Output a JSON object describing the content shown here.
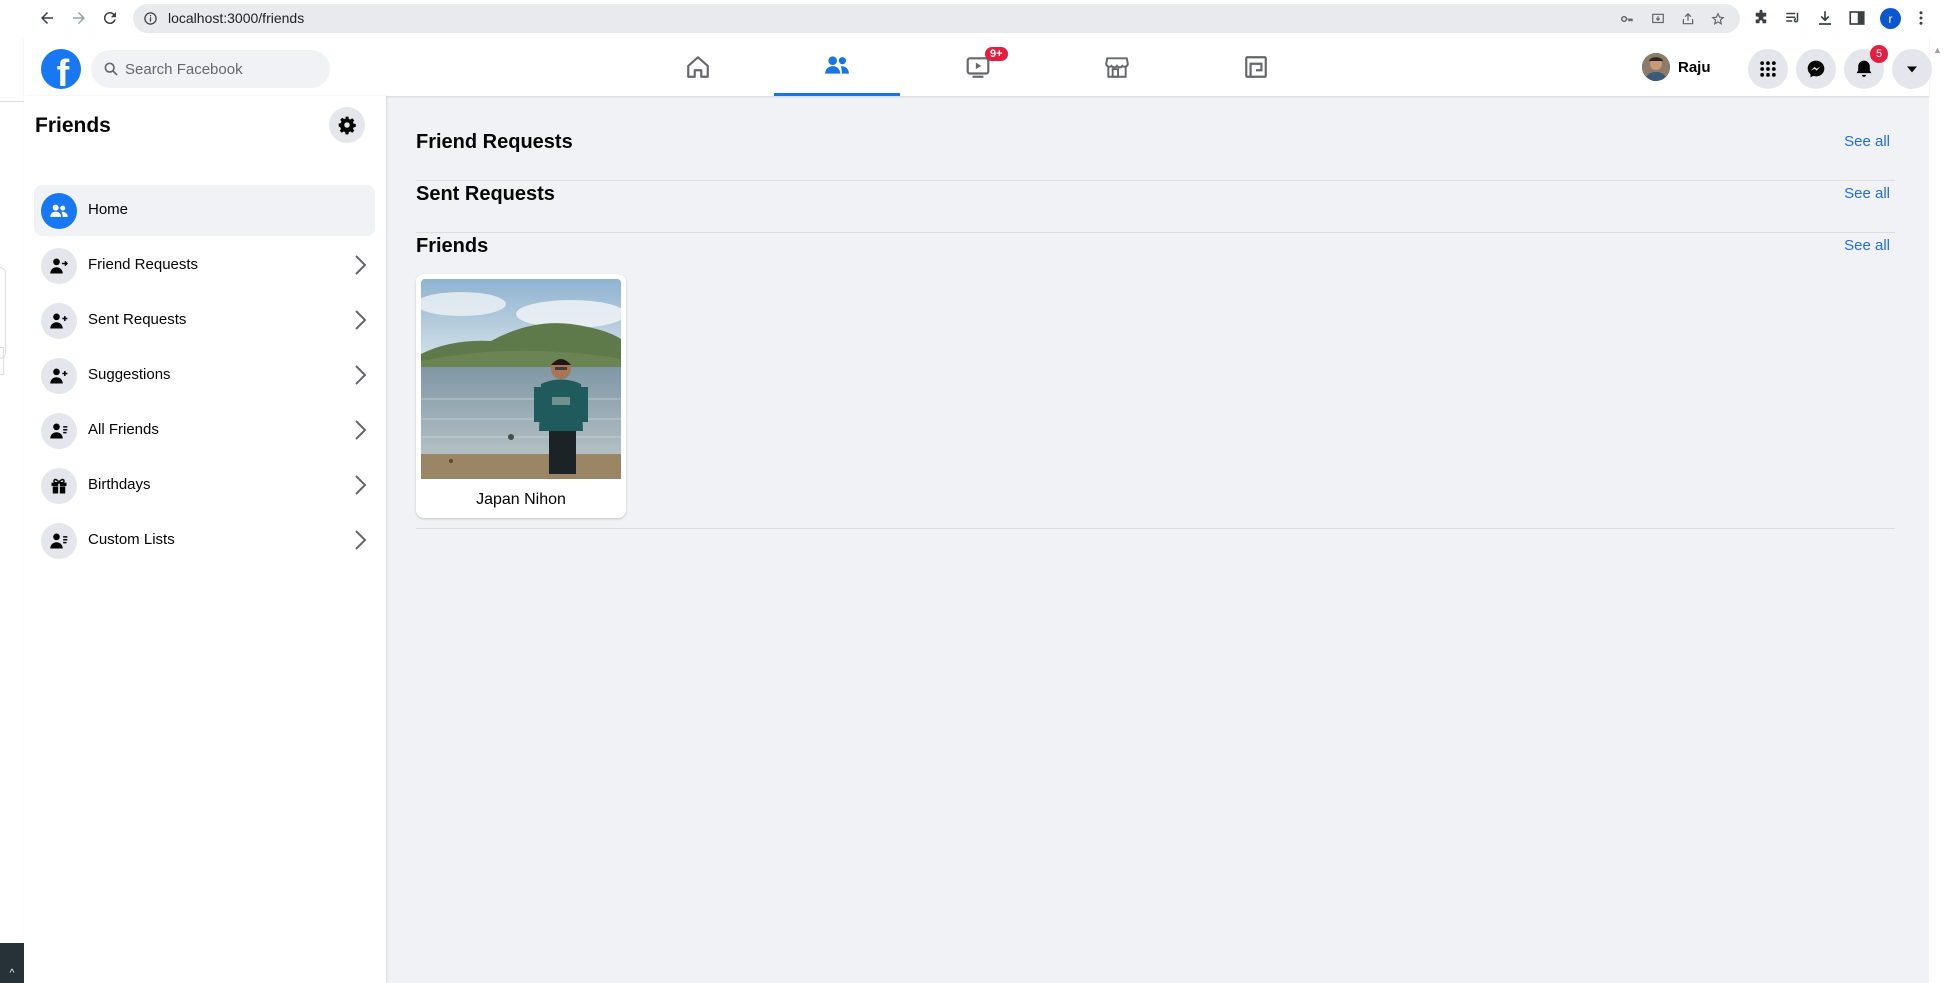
{
  "browser": {
    "url": "localhost:3000/friends",
    "profile_initial": "r"
  },
  "fb_nav": {
    "logo_letter": "f",
    "search_placeholder": "Search Facebook",
    "watch_badge": "9+",
    "user_name": "Raju",
    "notifications_badge": "5"
  },
  "sidebar": {
    "title": "Friends",
    "items": [
      {
        "label": "Home",
        "icon": "friends-home-icon",
        "active": true
      },
      {
        "label": "Friend Requests",
        "icon": "friend-requests-icon"
      },
      {
        "label": "Sent Requests",
        "icon": "sent-requests-icon"
      },
      {
        "label": "Suggestions",
        "icon": "suggestions-icon"
      },
      {
        "label": "All Friends",
        "icon": "all-friends-icon"
      },
      {
        "label": "Birthdays",
        "icon": "gift-icon"
      },
      {
        "label": "Custom Lists",
        "icon": "custom-lists-icon"
      }
    ]
  },
  "main": {
    "sections": [
      {
        "title": "Friend Requests",
        "see_all": "See all"
      },
      {
        "title": "Sent Requests",
        "see_all": "See all"
      },
      {
        "title": "Friends",
        "see_all": "See all"
      }
    ],
    "friends": [
      {
        "name": "Japan Nihon"
      }
    ]
  },
  "colors": {
    "accent": "#1877f2",
    "link": "#216fdb",
    "badge": "#e41e3f",
    "background": "#f0f2f5"
  }
}
